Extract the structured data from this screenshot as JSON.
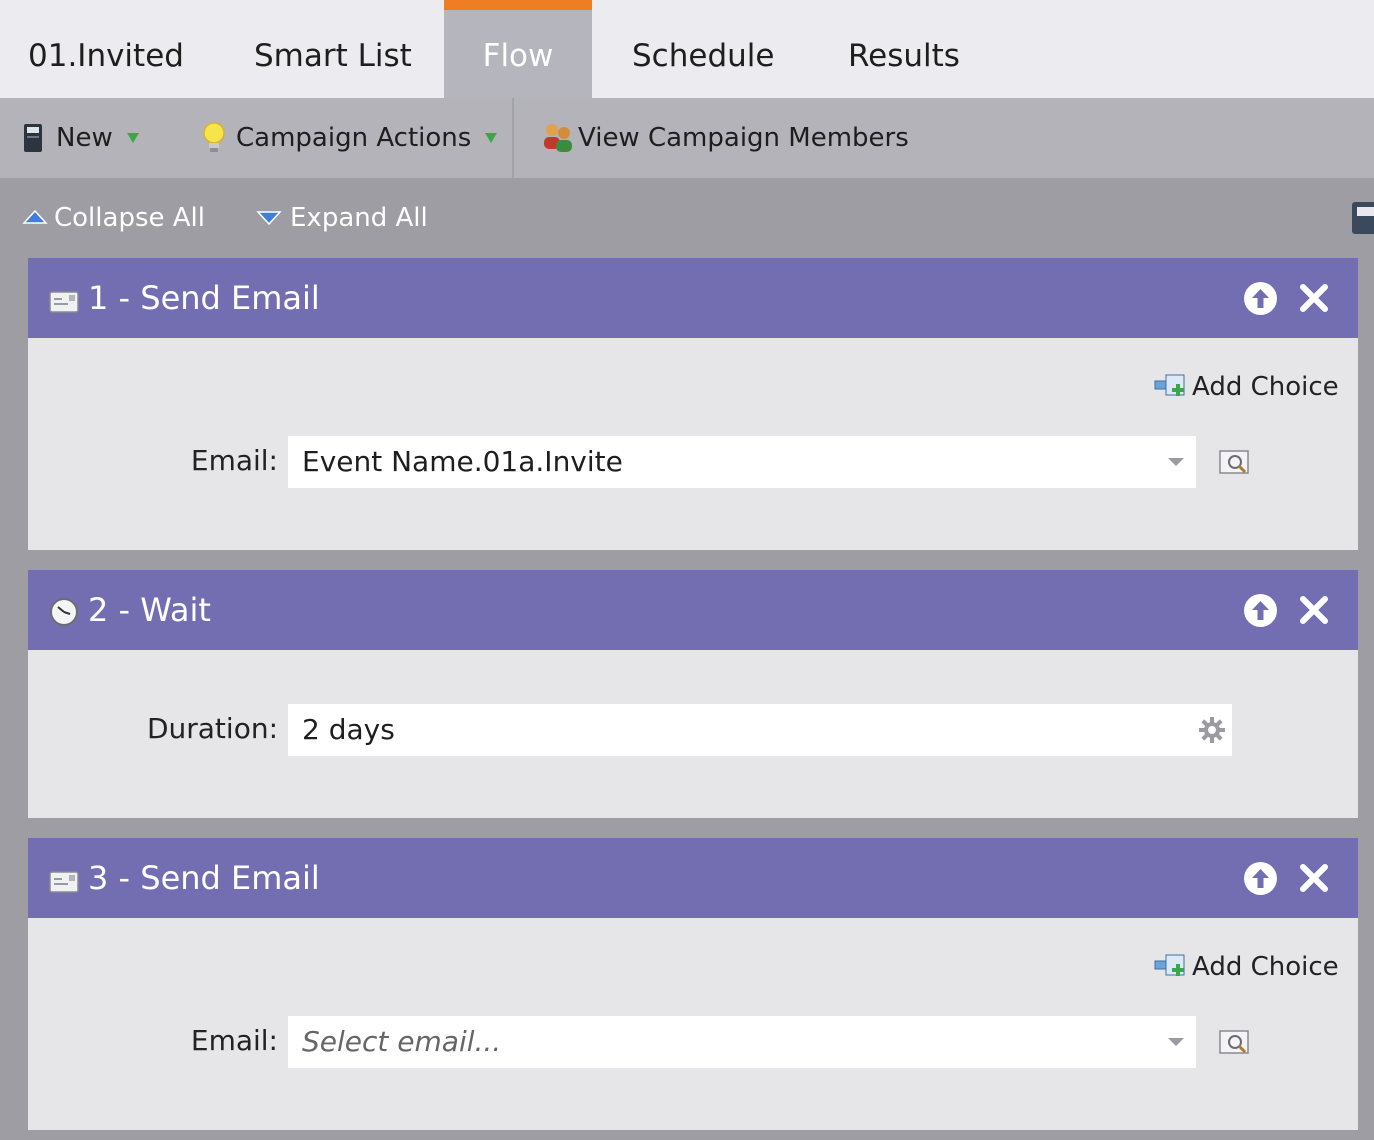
{
  "tabs": [
    {
      "label": "01.Invited"
    },
    {
      "label": "Smart List"
    },
    {
      "label": "Flow"
    },
    {
      "label": "Schedule"
    },
    {
      "label": "Results"
    }
  ],
  "active_tab": "Flow",
  "toolbar": {
    "new_label": "New",
    "campaign_actions_label": "Campaign Actions",
    "view_members_label": "View Campaign Members"
  },
  "controls": {
    "collapse_all": "Collapse All",
    "expand_all": "Expand All"
  },
  "steps": [
    {
      "title": "1 - Send Email",
      "icon": "email-icon",
      "add_choice_label": "Add Choice",
      "field_label": "Email:",
      "field_value": "Event Name.01a.Invite"
    },
    {
      "title": "2 - Wait",
      "icon": "clock-icon",
      "field_label": "Duration:",
      "field_value": "2 days"
    },
    {
      "title": "3 - Send Email",
      "icon": "email-icon",
      "add_choice_label": "Add Choice",
      "field_label": "Email:",
      "field_placeholder": "Select email..."
    }
  ],
  "colors": {
    "step_header": "#736db2",
    "active_tab_accent": "#ef7d22",
    "page_background": "#9d9da3"
  }
}
